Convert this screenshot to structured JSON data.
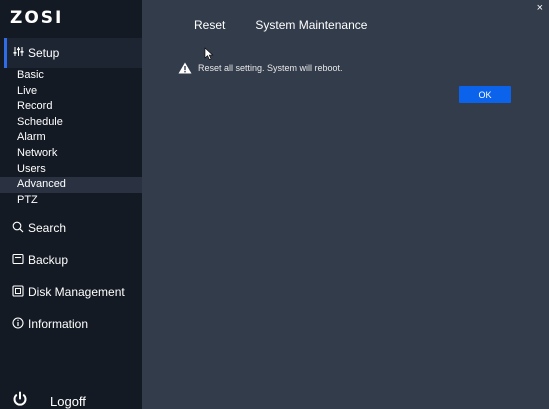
{
  "app": {
    "logo": "ZOSI"
  },
  "sidebar": {
    "setup_label": "Setup",
    "setup_icon": "sliders-icon",
    "submenu": [
      {
        "label": "Basic"
      },
      {
        "label": "Live"
      },
      {
        "label": "Record"
      },
      {
        "label": "Schedule"
      },
      {
        "label": "Alarm"
      },
      {
        "label": "Network"
      },
      {
        "label": "Users"
      },
      {
        "label": "Advanced",
        "active": true
      },
      {
        "label": "PTZ"
      }
    ],
    "sections": {
      "search": {
        "label": "Search",
        "icon": "search-icon"
      },
      "backup": {
        "label": "Backup",
        "icon": "backup-icon"
      },
      "disk": {
        "label": "Disk Management",
        "icon": "disk-icon"
      },
      "info": {
        "label": "Information",
        "icon": "info-icon"
      }
    },
    "logoff": {
      "label": "Logoff",
      "icon": "power-icon"
    }
  },
  "main": {
    "tabs": [
      {
        "label": "Reset"
      },
      {
        "label": "System Maintenance"
      }
    ],
    "close_glyph": "×",
    "warning_text": "Reset all setting. System will reboot.",
    "ok_label": "OK"
  },
  "colors": {
    "sidebar_bg": "#141a24",
    "main_bg": "#333c4b",
    "accent": "#0b63ec",
    "active_indicator": "#2f6ce8"
  }
}
